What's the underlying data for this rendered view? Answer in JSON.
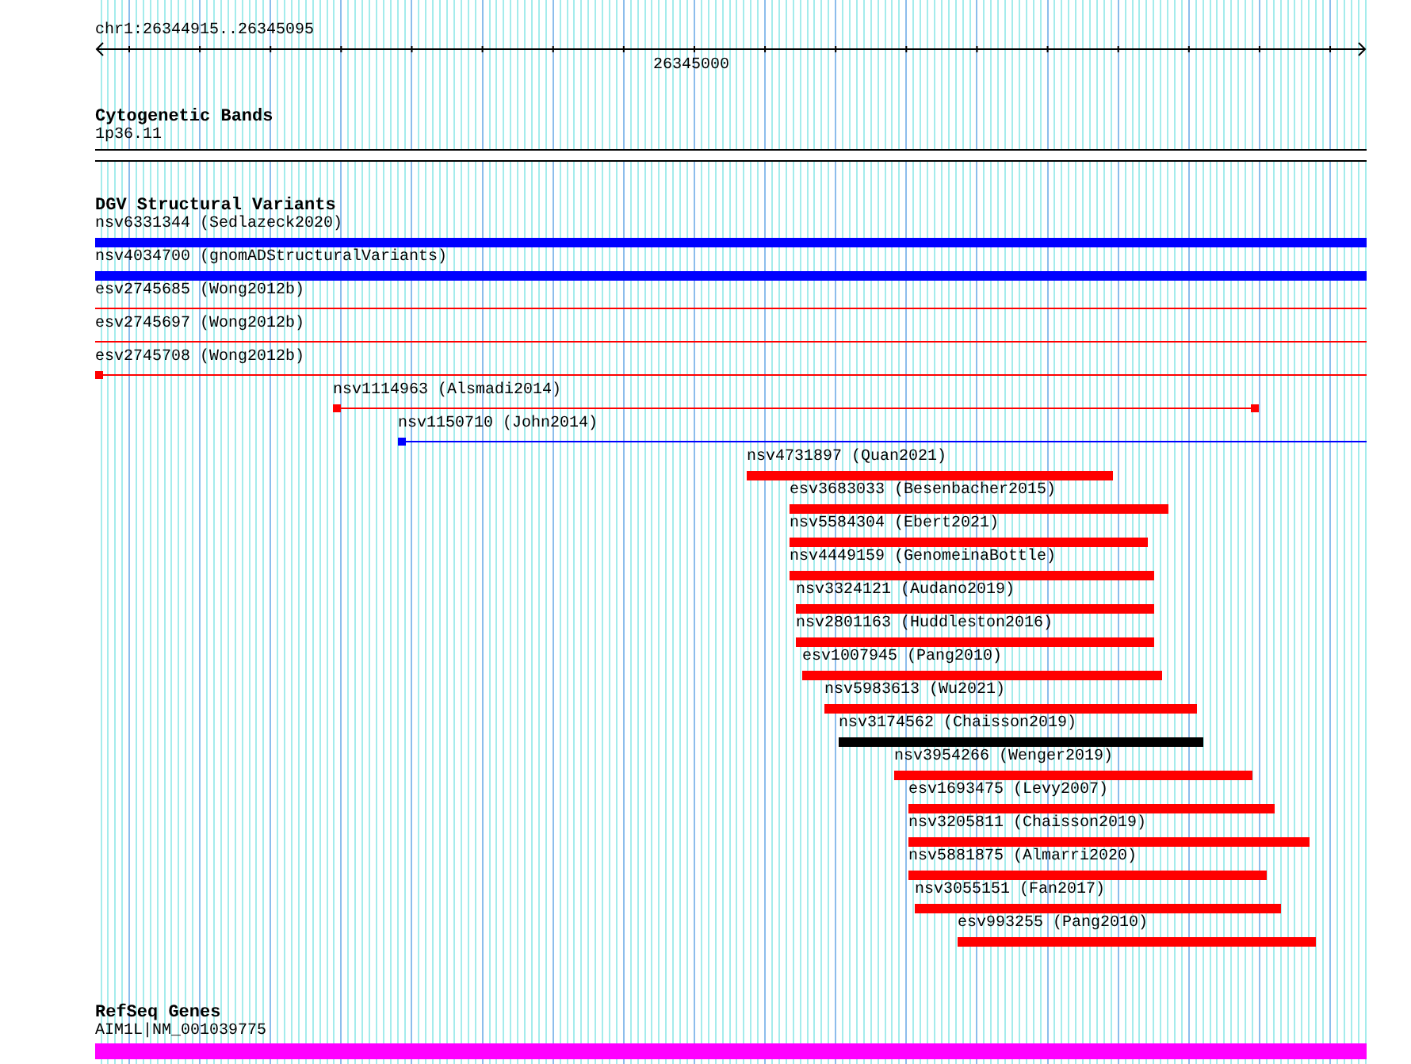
{
  "position": {
    "label": "chr1:26344915..26345095"
  },
  "ruler": {
    "tick_label": "26345000"
  },
  "tracks": [
    {
      "title": "Cytogenetic Bands",
      "items": [
        {
          "label": "1p36.11",
          "kind": "band"
        }
      ]
    },
    {
      "title": "DGV Structural Variants",
      "items": [
        {
          "label": "nsv6331344 (Sedlazeck2020)",
          "kind": "bar",
          "color": "#0000ff"
        },
        {
          "label": "nsv4034700 (gnomADStructuralVariants)",
          "kind": "bar",
          "color": "#0000ff"
        },
        {
          "label": "esv2745685 (Wong2012b)",
          "kind": "line",
          "color": "#ff0000"
        },
        {
          "label": "esv2745697 (Wong2012b)",
          "kind": "line",
          "color": "#ff0000"
        },
        {
          "label": "esv2745708 (Wong2012b)",
          "kind": "line",
          "color": "#ff0000"
        },
        {
          "label": "nsv1114963 (Alsmadi2014)",
          "kind": "line",
          "color": "#ff0000"
        },
        {
          "label": "nsv1150710 (John2014)",
          "kind": "line",
          "color": "#0000ff"
        },
        {
          "label": "nsv4731897 (Quan2021)",
          "kind": "bar",
          "color": "#ff0000"
        },
        {
          "label": "esv3683033 (Besenbacher2015)",
          "kind": "bar",
          "color": "#ff0000"
        },
        {
          "label": "nsv5584304 (Ebert2021)",
          "kind": "bar",
          "color": "#ff0000"
        },
        {
          "label": "nsv4449159 (GenomeinaBottle)",
          "kind": "bar",
          "color": "#ff0000"
        },
        {
          "label": "nsv3324121 (Audano2019)",
          "kind": "bar",
          "color": "#ff0000"
        },
        {
          "label": "nsv2801163 (Huddleston2016)",
          "kind": "bar",
          "color": "#ff0000"
        },
        {
          "label": "esv1007945 (Pang2010)",
          "kind": "bar",
          "color": "#ff0000"
        },
        {
          "label": "nsv5983613 (Wu2021)",
          "kind": "bar",
          "color": "#ff0000"
        },
        {
          "label": "nsv3174562 (Chaisson2019)",
          "kind": "bar",
          "color": "#000000"
        },
        {
          "label": "nsv3954266 (Wenger2019)",
          "kind": "bar",
          "color": "#ff0000"
        },
        {
          "label": "esv1693475 (Levy2007)",
          "kind": "bar",
          "color": "#ff0000"
        },
        {
          "label": "nsv3205811 (Chaisson2019)",
          "kind": "bar",
          "color": "#ff0000"
        },
        {
          "label": "nsv5881875 (Almarri2020)",
          "kind": "bar",
          "color": "#ff0000"
        },
        {
          "label": "nsv3055151 (Fan2017)",
          "kind": "bar",
          "color": "#ff0000"
        },
        {
          "label": "esv993255 (Pang2010)",
          "kind": "bar",
          "color": "#ff0000"
        }
      ]
    },
    {
      "title": "RefSeq Genes",
      "items": [
        {
          "label": "AIM1L|NM_001039775",
          "kind": "exon",
          "color": "#ff00ff"
        }
      ]
    }
  ]
}
